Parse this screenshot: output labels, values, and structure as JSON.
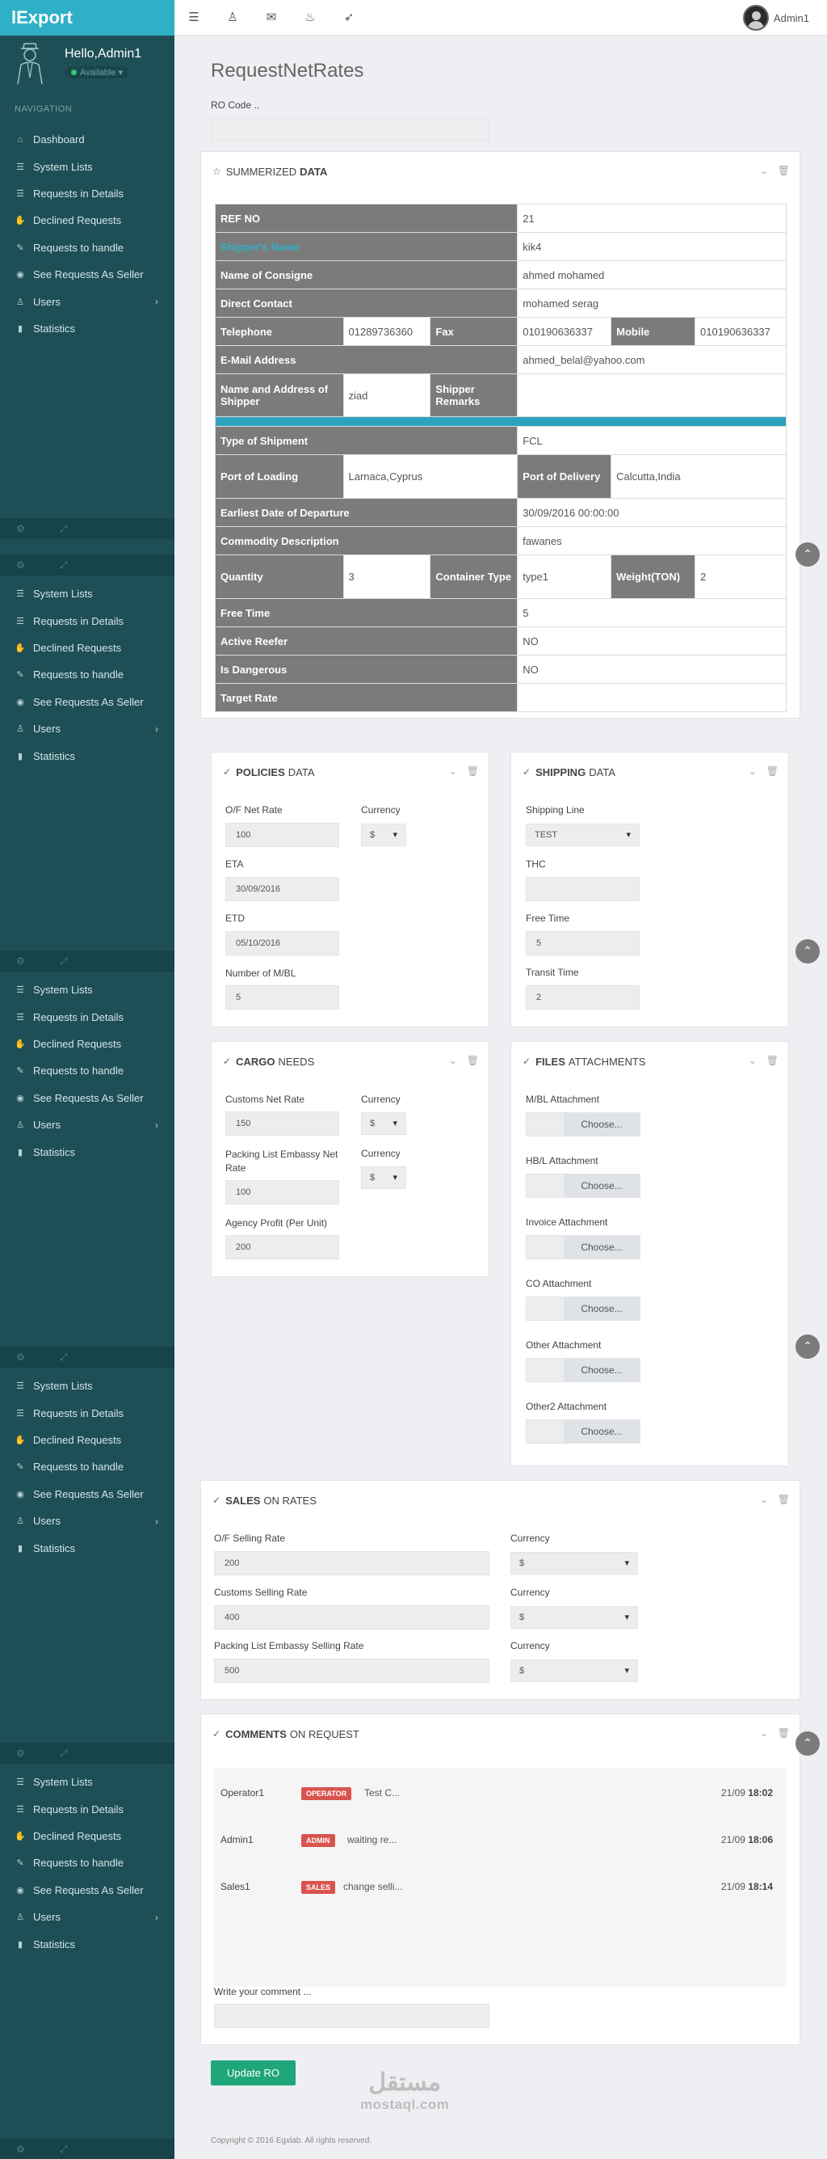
{
  "brand": "lExport",
  "profile": {
    "greeting": "Hello,Admin1",
    "status": "Available"
  },
  "nav_heading": "NAVIGATION",
  "nav_main": [
    {
      "icon": "home-icon",
      "glyph": "⌂",
      "label": "Dashboard"
    },
    {
      "icon": "list-icon",
      "glyph": "☰",
      "label": "System Lists"
    },
    {
      "icon": "list-icon",
      "glyph": "☰",
      "label": "Requests in Details"
    },
    {
      "icon": "thumbs-down-icon",
      "glyph": "✋",
      "label": "Declined Requests"
    },
    {
      "icon": "wrench-icon",
      "glyph": "✎",
      "label": "Requests to handle"
    },
    {
      "icon": "eye-icon",
      "glyph": "◉",
      "label": "See Requests As Seller"
    },
    {
      "icon": "user-icon",
      "glyph": "♙",
      "label": "Users"
    },
    {
      "icon": "bar-chart-icon",
      "glyph": "▮",
      "label": "Statistics"
    }
  ],
  "nav_repeat": [
    {
      "icon": "list-icon",
      "glyph": "☰",
      "label": "System Lists"
    },
    {
      "icon": "list-icon",
      "glyph": "☰",
      "label": "Requests in Details"
    },
    {
      "icon": "thumbs-down-icon",
      "glyph": "✋",
      "label": "Declined Requests"
    },
    {
      "icon": "wrench-icon",
      "glyph": "✎",
      "label": "Requests to handle"
    },
    {
      "icon": "eye-icon",
      "glyph": "◉",
      "label": "See Requests As Seller"
    },
    {
      "icon": "user-icon",
      "glyph": "♙",
      "label": "Users"
    },
    {
      "icon": "bar-chart-icon",
      "glyph": "▮",
      "label": "Statistics"
    }
  ],
  "topbar": {
    "username": "Admin1"
  },
  "page": {
    "title": "RequestNetRates",
    "ro_label": "RO Code .."
  },
  "summary": {
    "title_light": "SUMMERIZED",
    "title_bold": "DATA",
    "ref_no_label": "REF NO",
    "ref_no": "21",
    "shipper_link": "Shipper's Name",
    "shipper_name": "kik4",
    "consigne_label": "Name of Consigne",
    "consigne": "ahmed mohamed",
    "contact_label": "Direct Contact",
    "contact": "mohamed serag",
    "telephone_label": "Telephone",
    "telephone": "01289736360",
    "fax_label": "Fax",
    "fax": "010190636337",
    "mobile_label": "Mobile",
    "mobile": "010190636337",
    "email_label": "E-Mail Address",
    "email": "ahmed_belal@yahoo.com",
    "address_label": "Name and Address of Shipper",
    "address": "ziad",
    "remarks_label": "Shipper Remarks",
    "remarks": "",
    "shipment_type_label": "Type of Shipment",
    "shipment_type": "FCL",
    "loading_label": "Port of Loading",
    "loading": "Larnaca,Cyprus",
    "delivery_label": "Port of Delivery",
    "delivery": "Calcutta,India",
    "departure_label": "Earliest Date of Departure",
    "departure": "30/09/2016 00:00:00",
    "commodity_label": "Commodity Description",
    "commodity": "fawanes",
    "quantity_label": "Quantity",
    "quantity": "3",
    "container_label": "Container Type",
    "container": "type1",
    "weight_label": "Weight(TON)",
    "weight": "2",
    "free_time_label": "Free Time",
    "free_time": "5",
    "reefer_label": "Active Reefer",
    "reefer": "NO",
    "dangerous_label": "Is Dangerous",
    "dangerous": "NO",
    "target_label": "Target Rate",
    "target": ""
  },
  "policies": {
    "title_bold": "POLICIES",
    "title_light": "DATA",
    "of_label": "O/F Net Rate",
    "of_value": "100",
    "currency_label": "Currency",
    "currency_value": "$",
    "eta_label": "ETA",
    "eta_value": "30/09/2016",
    "etd_label": "ETD",
    "etd_value": "05/10/2016",
    "mbl_label": "Number of M/BL",
    "mbl_value": "5"
  },
  "shipping": {
    "title_bold": "SHIPPING",
    "title_light": "DATA",
    "line_label": "Shipping Line",
    "line_value": "TEST",
    "thc_label": "THC",
    "thc_value": "",
    "free_label": "Free Time",
    "free_value": "5",
    "transit_label": "Transit Time",
    "transit_value": "2"
  },
  "cargo": {
    "title_bold": "CARGO",
    "title_light": "NEEDS",
    "customs_label": "Customs Net Rate",
    "customs_value": "150",
    "currency1_label": "Currency",
    "currency1_value": "$",
    "packing_label": "Packing List Embassy Net Rate",
    "packing_value": "100",
    "currency2_label": "Currency",
    "currency2_value": "$",
    "agency_label": "Agency Profit (Per Unit)",
    "agency_value": "200"
  },
  "files": {
    "title_bold": "FILES",
    "title_light": "ATTACHMENTS",
    "choose": "Choose...",
    "items": [
      "M/BL Attachment",
      "HB/L Attachment",
      "Invoice Attachment",
      "CO Attachment",
      "Other Attachment",
      "Other2 Attachment"
    ]
  },
  "sales": {
    "title_bold": "SALES",
    "title_light": "ON RATES",
    "of_label": "O/F Selling Rate",
    "of_value": "200",
    "customs_label": "Customs Selling Rate",
    "customs_value": "400",
    "packing_label": "Packing List Embassy Selling Rate",
    "packing_value": "500",
    "currency_label": "Currency",
    "currency_value": "$"
  },
  "comments": {
    "title_bold": "COMMENTS",
    "title_light": "ON REQUEST",
    "items": [
      {
        "name": "Operator1",
        "badge": "OPERATOR",
        "text": "Test C...",
        "date": "21/09",
        "time": "18:02"
      },
      {
        "name": "Admin1",
        "badge": "ADMIN",
        "text": "waiting re...",
        "date": "21/09",
        "time": "18:06"
      },
      {
        "name": "Sales1",
        "badge": "SALES",
        "text": "change selli...",
        "date": "21/09",
        "time": "18:14"
      }
    ],
    "write_label": "Write your comment ..."
  },
  "actions": {
    "update": "Update RO"
  },
  "watermark": {
    "ar": "مستقل",
    "en": "mostaql.com"
  },
  "footer": "Copyright © 2016 Egxlab. All rights reserved.",
  "colors": {
    "brand": "#2fb0c6",
    "sidebar": "#1e4f56",
    "label_bg": "#7b7b7b",
    "button": "#1fa67a",
    "badge": "#d9534f"
  }
}
